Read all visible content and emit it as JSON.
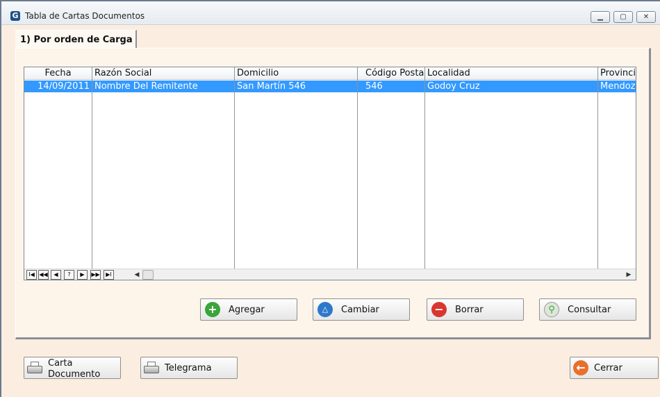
{
  "window": {
    "title": "Tabla de Cartas Documentos",
    "controls": {
      "minimize": "▁",
      "maximize": "▢",
      "close": "✕"
    }
  },
  "tabs": [
    {
      "label": "1) Por orden de Carga",
      "selected": true
    }
  ],
  "grid": {
    "columns": [
      "Fecha",
      "Razón Social",
      "Domicilio",
      "Código Posta",
      "Localidad",
      "Provinci"
    ],
    "rows": [
      {
        "fecha": "14/09/2011",
        "razon_social": "Nombre Del Remitente",
        "domicilio": "San Martín 546",
        "codigo_postal": "546",
        "localidad": "Godoy Cruz",
        "provincia": "Mendoz",
        "selected": true
      }
    ],
    "navigator": [
      "I◀",
      "◀◀",
      "◀",
      "?",
      "▶",
      "▶▶",
      "▶I"
    ],
    "scroll_left": "◀",
    "scroll_right": "▶"
  },
  "actions": {
    "add": "Agregar",
    "change": "Cambiar",
    "delete": "Borrar",
    "view": "Consultar"
  },
  "footer": {
    "carta_line1": "Carta",
    "carta_line2": "Documento",
    "telegram": "Telegrama",
    "close": "Cerrar"
  },
  "colors": {
    "selection": "#3399ff",
    "background": "#fbeee0",
    "add_icon": "#3aa53a",
    "change_icon": "#2e78c9",
    "delete_icon": "#d8362f",
    "close_icon": "#e8702a"
  },
  "icons": {
    "add": "plus-circle-icon",
    "change": "triangle-circle-icon",
    "delete": "minus-circle-icon",
    "view": "magnifier-plus-icon",
    "print": "printer-icon",
    "close": "arrow-left-circle-icon"
  }
}
